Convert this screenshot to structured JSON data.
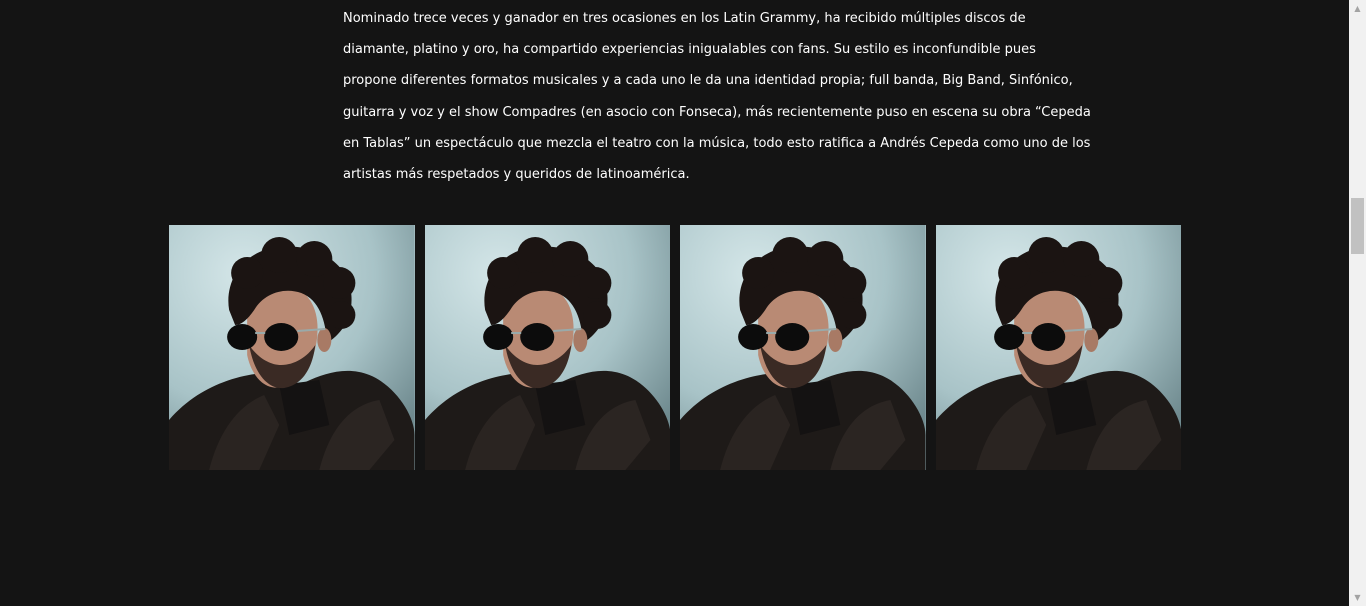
{
  "bio": {
    "text": "Nominado trece veces y ganador en tres ocasiones en los Latin Grammy, ha recibido múltiples discos de diamante, platino y oro, ha compartido experiencias inigualables con fans. Su estilo es inconfundible pues propone diferentes formatos musicales y a cada uno le da una identidad propia; full banda, Big Band, Sinfónico, guitarra y voz y el show Compadres (en asocio con Fonseca), más recientemente puso en escena su obra “Cepeda en Tablas” un espectáculo que mezcla el teatro con la música, todo esto ratifica a Andrés Cepeda como uno de los artistas más respetados y queridos de latinoamérica."
  },
  "gallery": {
    "photos": [
      {
        "icon": "artist-photo"
      },
      {
        "icon": "artist-photo"
      },
      {
        "icon": "artist-photo"
      },
      {
        "icon": "artist-photo"
      }
    ]
  },
  "colors": {
    "background": "#141414",
    "text": "#ffffff",
    "photo_backdrop": "#b8d0d4",
    "scrollbar_track": "#f1f1f1",
    "scrollbar_thumb": "#c1c1c1"
  },
  "scrollbar": {
    "up_icon": "scroll-up-arrow",
    "down_icon": "scroll-down-arrow"
  }
}
